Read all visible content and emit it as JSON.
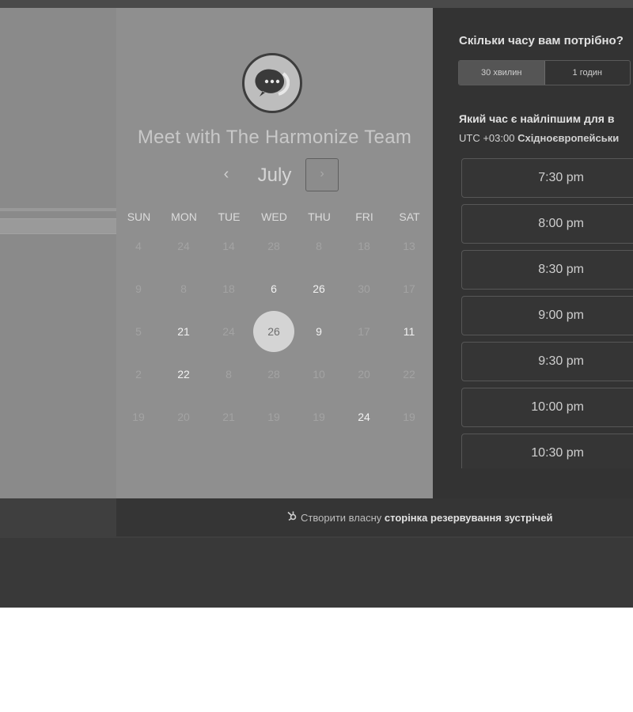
{
  "calendar": {
    "title": "Meet with The Harmonize Team",
    "month": "July",
    "prev_icon": "‹",
    "next_icon": "›",
    "weekdays": [
      "SUN",
      "MON",
      "TUE",
      "WED",
      "THU",
      "FRI",
      "SAT"
    ],
    "days": [
      [
        "4",
        "24",
        "14",
        "28",
        "8",
        "18",
        "13"
      ],
      [
        "9",
        "8",
        "18",
        "6",
        "26",
        "30",
        "17"
      ],
      [
        "5",
        "21",
        "24",
        "26",
        "9",
        "17",
        "11"
      ],
      [
        "2",
        "22",
        "8",
        "28",
        "10",
        "20",
        "22"
      ],
      [
        "19",
        "20",
        "21",
        "19",
        "19",
        "24",
        "19"
      ]
    ],
    "selected_day": "26"
  },
  "booking": {
    "duration_question": "Скільки часу вам потрібно?",
    "durations": [
      "30 хвилин",
      "1 годин"
    ],
    "selected_duration": "30 хвилин",
    "time_question": "Який час є найліпшим для в",
    "timezone_offset": "UTC +03:00",
    "timezone_name": "Східноєвропейськи",
    "slots": [
      "7:30 pm",
      "8:00 pm",
      "8:30 pm",
      "9:00 pm",
      "9:30 pm",
      "10:00 pm",
      "10:30 pm"
    ]
  },
  "footer": {
    "text_prefix": "Створити власну",
    "text_bold": "сторінка резервування зустрічей"
  },
  "colors": {
    "calendar_bg": "#8f8f8f",
    "right_bg": "#333333",
    "selected_day_bg": "#d4d4d4"
  },
  "icons": {
    "logo": "chat-bubble-icon",
    "footer": "hubspot-sprocket-icon"
  }
}
